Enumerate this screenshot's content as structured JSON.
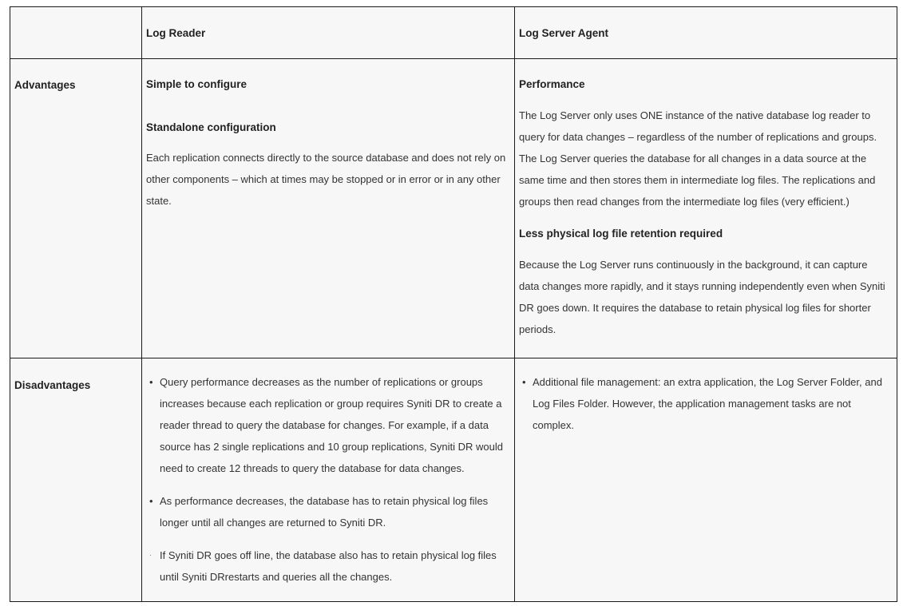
{
  "table": {
    "header": {
      "corner": "",
      "col1": "Log Reader",
      "col2": "Log Server Agent"
    },
    "advantages": {
      "label": "Advantages",
      "log_reader": {
        "heading1": "Simple to configure",
        "heading2": "Standalone configuration",
        "paragraph": "Each replication connects directly to the source database and does not rely on other components – which at times may be stopped or in error or in any other state."
      },
      "log_server": {
        "heading1": "Performance",
        "paragraph1": "The Log Server only uses ONE instance of the native database log reader to query for data changes – regardless of the number of replications and groups. The Log Server queries the database for all changes in a data source at the same time and then stores them in intermediate log files. The replications and groups then read changes from the intermediate log files (very efficient.)",
        "heading2": "Less physical log file retention required",
        "paragraph2": "Because the Log Server runs continuously in the background, it can capture data changes more rapidly, and it stays running independently even when Syniti DR goes down. It requires the database to retain physical log files for shorter periods."
      }
    },
    "disadvantages": {
      "label": "Disadvantages",
      "log_reader_items": [
        {
          "bullet": "•",
          "text": "Query performance decreases as the number of replications or groups increases because each replication or group requires Syniti DR to create a reader thread to query the database for changes. For example, if a data source has 2 single replications and 10 group replications, Syniti DR would need to create 12 threads to query the database for data changes."
        },
        {
          "bullet": "•",
          "text": "As performance decreases, the database has to retain physical log files longer until all changes are returned to Syniti DR."
        },
        {
          "bullet": "·",
          "text": "If Syniti DR goes off line, the database also has to retain physical log files until Syniti DRrestarts and queries all the changes."
        }
      ],
      "log_server_items": [
        {
          "bullet": "•",
          "text": "Additional file management: an extra application, the Log Server Folder, and Log Files Folder. However, the application management tasks are not complex."
        }
      ]
    }
  }
}
